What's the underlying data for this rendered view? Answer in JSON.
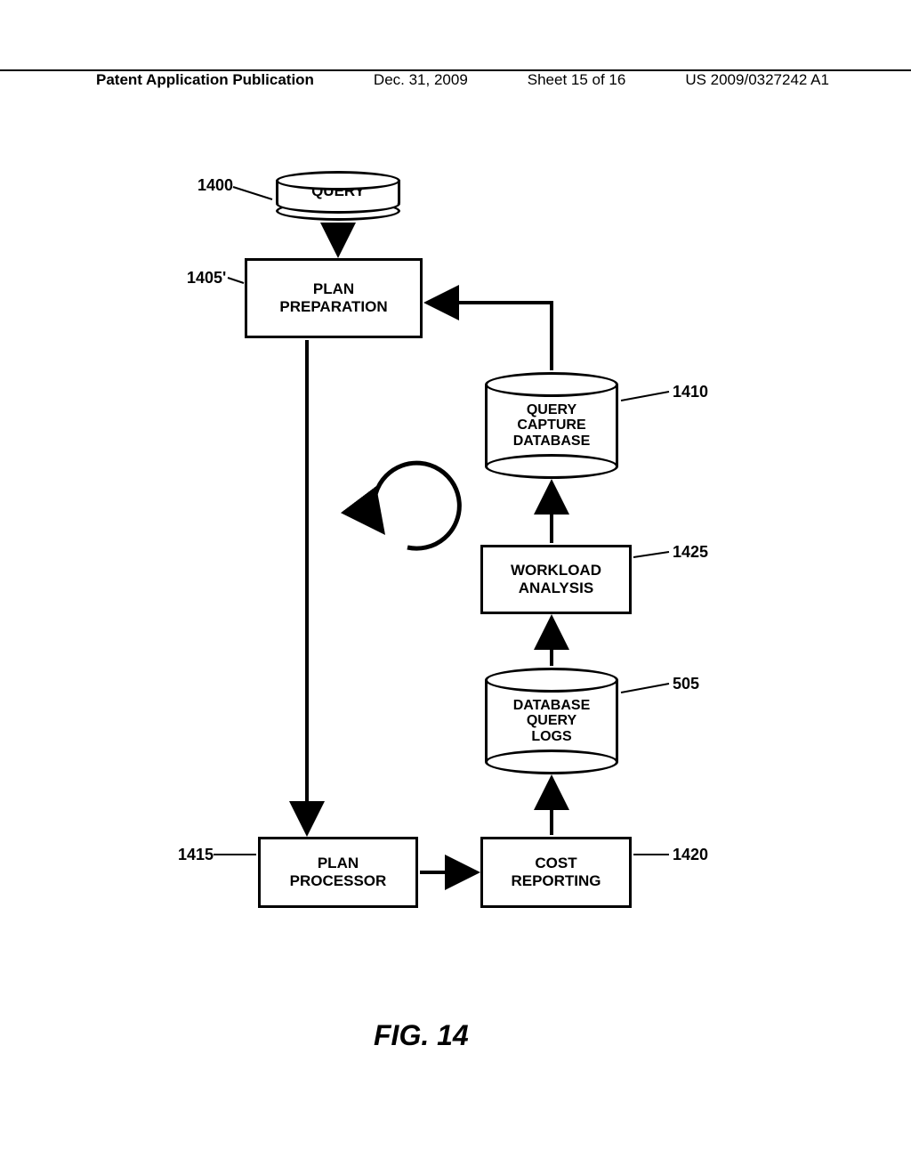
{
  "header": {
    "pubLabel": "Patent Application Publication",
    "date": "Dec. 31, 2009",
    "sheet": "Sheet 15 of 16",
    "pubNumber": "US 2009/0327242 A1"
  },
  "nodes": {
    "query": "QUERY",
    "planPreparation": "PLAN\nPREPARATION",
    "queryCaptureDb": "QUERY\nCAPTURE\nDATABASE",
    "workloadAnalysis": "WORKLOAD\nANALYSIS",
    "dbQueryLogs": "DATABASE\nQUERY\nLOGS",
    "planProcessor": "PLAN\nPROCESSOR",
    "costReporting": "COST\nREPORTING"
  },
  "refs": {
    "query": "1400",
    "planPreparation": "1405'",
    "queryCaptureDb": "1410",
    "workloadAnalysis": "1425",
    "dbQueryLogs": "505",
    "planProcessor": "1415",
    "costReporting": "1420"
  },
  "figure": "FIG. 14"
}
